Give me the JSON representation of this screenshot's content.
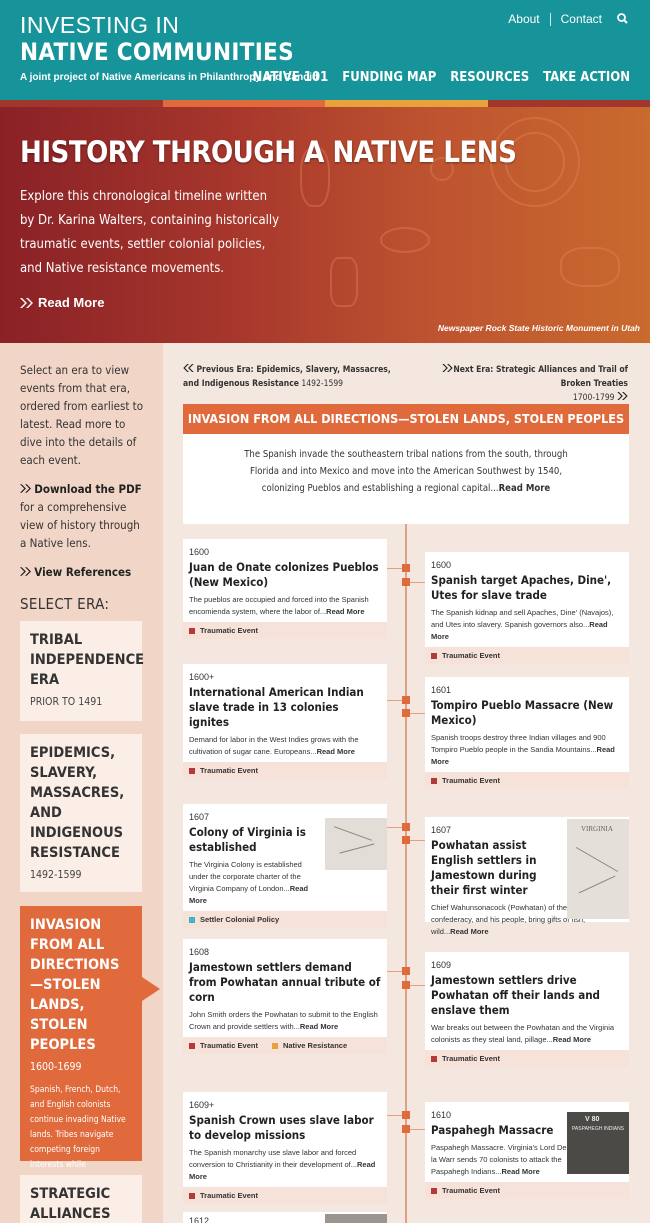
{
  "header": {
    "logo_line1": "INVESTING IN",
    "logo_line2": "NATIVE COMMUNITIES",
    "tagline": "A joint project of Native Americans in Philanthropy and Candid",
    "links": [
      "About",
      "Contact"
    ],
    "nav": [
      "NATIVE 101",
      "FUNDING MAP",
      "RESOURCES",
      "TAKE ACTION"
    ]
  },
  "hero": {
    "title": "HISTORY THROUGH A NATIVE LENS",
    "text": "Explore this chronological timeline written by Dr. Karina Walters, containing historically traumatic events, settler colonial policies, and Native resistance movements.",
    "read_more": "Read More",
    "caption": "Newspaper Rock State Historic Monument in Utah"
  },
  "colors": {
    "teal": "#16949a",
    "accent": "#e06a3c",
    "traumatic": "#b23a3a",
    "settler": "#3fb6c4",
    "resistance": "#e9a13b"
  },
  "sidebar": {
    "intro": "Select an era to view events from that era, ordered from earliest to latest. Read more to dive into the details of each event.",
    "pdf_bold": "Download the PDF",
    "pdf_rest": " for a comprehensive view of history through a Native lens.",
    "references": "View References",
    "select_era": "SELECT ERA:",
    "eras": [
      {
        "title": "TRIBAL INDEPENDENCE ERA",
        "dates": "PRIOR TO 1491"
      },
      {
        "title": "EPIDEMICS, SLAVERY, MASSACRES, AND INDIGENOUS RESISTANCE",
        "dates": "1492-1599"
      },
      {
        "title": "INVASION FROM ALL DIRECTIONS—STOLEN LANDS, STOLEN PEOPLES",
        "dates": "1600-1699",
        "summary": "Spanish, French, Dutch, and English colonists continue invading Native lands. Tribes navigate competing foreign interests while maintaining their sovereignty through treaty negotiations."
      },
      {
        "title": "STRATEGIC ALLIANCES AND"
      }
    ]
  },
  "main": {
    "prev_label": "Previous Era: Epidemics, Slavery, Massacres, and Indigenous Resistance",
    "prev_years": "1492-1599",
    "next_label": "Next Era: Strategic Alliances and Trail of Broken Treaties",
    "next_years": "1700-1799",
    "banner_title": "INVASION FROM ALL DIRECTIONS—STOLEN LANDS, STOLEN PEOPLES",
    "banner_years": "1600-1699",
    "summary": "The Spanish invade the southeastern tribal nations from the south, through Florida and into Mexico and move into the American Southwest by 1540, colonizing Pueblos and establishing a regional capital...",
    "summary_more": "Read More"
  },
  "events": [
    {
      "year": "1600",
      "title": "Juan de Onate colonizes Pueblos (New Mexico)",
      "text": "The pueblos are occupied and forced into the Spanish encomienda system, where the labor of...",
      "more": "Read More",
      "tags": [
        "Traumatic Event"
      ]
    },
    {
      "year": "1600",
      "title": "Spanish target Apaches, Dine', Utes for slave trade",
      "text": "The Spanish kidnap and sell Apaches, Dine' (Navajos), and Utes into slavery. Spanish governors also...",
      "more": "Read More",
      "tags": [
        "Traumatic Event"
      ]
    },
    {
      "year": "1600+",
      "title": "International American Indian slave trade in 13 colonies ignites",
      "text": "Demand for labor in the West Indies grows with the cultivation of sugar cane. Europeans...",
      "more": "Read More",
      "tags": [
        "Traumatic Event"
      ]
    },
    {
      "year": "1601",
      "title": "Tompiro Pueblo Massacre (New Mexico)",
      "text": "Spanish troops destroy three Indian villages and 900 Tompiro Pueblo people in the Sandia Mountains...",
      "more": "Read More",
      "tags": [
        "Traumatic Event"
      ]
    },
    {
      "year": "1607",
      "title": "Colony of Virginia is established",
      "text": "The Virginia Colony is established under the corporate charter of the Virginia Company of London...",
      "more": "Read More",
      "tags": [
        "Settler Colonial Policy"
      ]
    },
    {
      "year": "1607",
      "title": "Powhatan assist English settlers in Jamestown during their first winter",
      "text": "Chief Wahunsonacock (Powhatan) of the Powhatan confederacy, and his people, bring gifts of fish, wild...",
      "more": "Read More",
      "thumb_text": "VIRGINIA"
    },
    {
      "year": "1608",
      "title": "Jamestown settlers demand from Powhatan annual tribute of corn",
      "text": "John Smith orders the Powhatan to submit to the English Crown and provide settlers with...",
      "more": "Read More",
      "tags": [
        "Traumatic Event",
        "Native Resistance"
      ]
    },
    {
      "year": "1609",
      "title": "Jamestown settlers drive Powhatan off their lands and enslave them",
      "text": "War breaks out between the Powhatan and the Virginia colonists as they steal land, pillage...",
      "more": "Read More",
      "tags": [
        "Traumatic Event"
      ]
    },
    {
      "year": "1609+",
      "title": "Spanish Crown uses slave labor to develop missions",
      "text": "The Spanish monarchy use slave labor and forced conversion to Christianity in their development of...",
      "more": "Read More",
      "tags": [
        "Traumatic Event"
      ]
    },
    {
      "year": "1610",
      "title": "Paspahegh Massacre",
      "text": "Paspahegh Massacre. Virginia's Lord De la Warr sends 70 colonists to attack the Paspahegh Indians...",
      "more": "Read More",
      "tags": [
        "Traumatic Event"
      ],
      "thumb_text": "PASPAHEGH INDIANS",
      "thumb_code": "V 80"
    },
    {
      "year": "1612"
    }
  ]
}
